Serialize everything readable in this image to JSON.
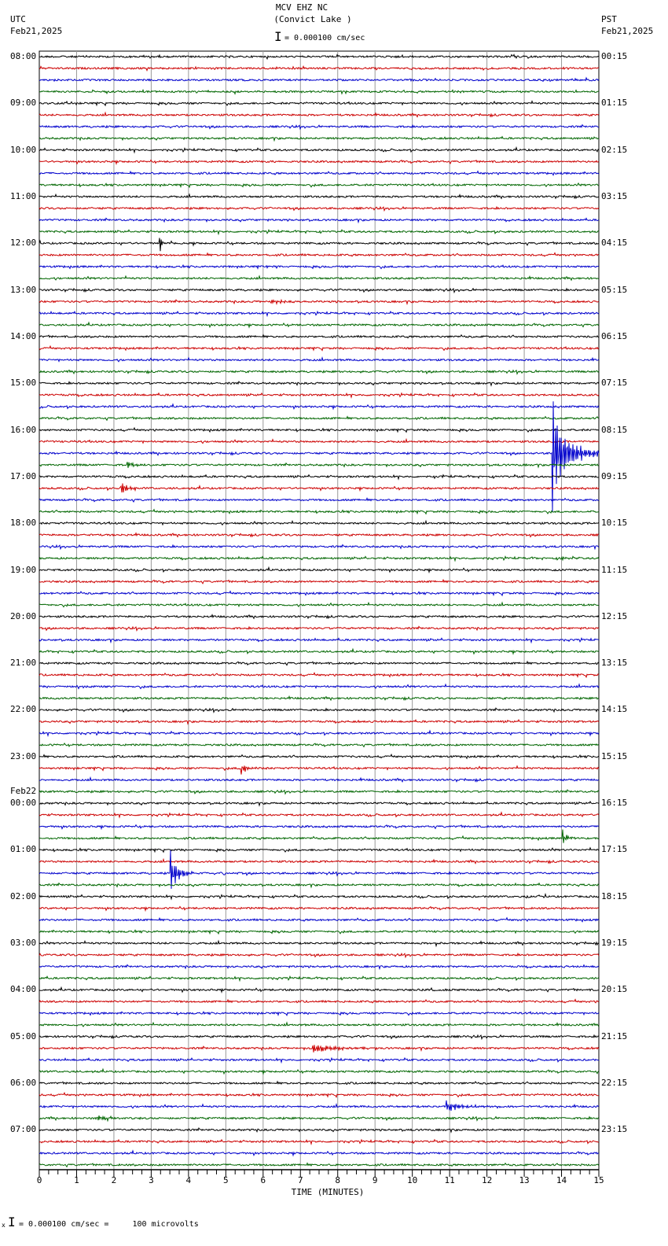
{
  "header": {
    "station": "MCV EHZ NC",
    "location": "(Convict Lake )",
    "scale": "= 0.000100 cm/sec",
    "left_tz": "UTC",
    "left_date": "Feb21,2025",
    "right_tz": "PST",
    "right_date": "Feb21,2025"
  },
  "footer": {
    "scale": "= 0.000100 cm/sec =     100 microvolts",
    "mark": "x"
  },
  "chart_data": {
    "type": "line",
    "title": "MCV EHZ NC (Convict Lake )",
    "xlabel": "TIME (MINUTES)",
    "xlim": [
      0,
      15
    ],
    "x_ticks": [
      "0",
      "1",
      "2",
      "3",
      "4",
      "5",
      "6",
      "7",
      "8",
      "9",
      "10",
      "11",
      "12",
      "13",
      "14",
      "15"
    ],
    "traces_per_hour": 4,
    "trace_count": 96,
    "trace_colors": [
      "#000000",
      "#cc0000",
      "#0000cc",
      "#006600"
    ],
    "left_labels": [
      "08:00",
      "09:00",
      "10:00",
      "11:00",
      "12:00",
      "13:00",
      "14:00",
      "15:00",
      "16:00",
      "17:00",
      "18:00",
      "19:00",
      "20:00",
      "21:00",
      "22:00",
      "23:00",
      "00:00",
      "01:00",
      "02:00",
      "03:00",
      "04:00",
      "05:00",
      "06:00",
      "07:00"
    ],
    "date_change_label": "Feb22",
    "right_labels": [
      "00:15",
      "01:15",
      "02:15",
      "03:15",
      "04:15",
      "05:15",
      "06:15",
      "07:15",
      "08:15",
      "09:15",
      "10:15",
      "11:15",
      "12:15",
      "13:15",
      "14:15",
      "15:15",
      "16:15",
      "17:15",
      "18:15",
      "19:15",
      "20:15",
      "21:15",
      "22:15",
      "23:15"
    ],
    "events": [
      {
        "trace": 16,
        "minute": 3.22,
        "amp": 30,
        "dur": 0.08,
        "dir": 1
      },
      {
        "trace": 18,
        "minute": 6.05,
        "amp": 3,
        "dur": 0.1,
        "dir": 0
      },
      {
        "trace": 21,
        "minute": 6.2,
        "amp": 6,
        "dur": 0.9,
        "dir": 0
      },
      {
        "trace": 34,
        "minute": 13.75,
        "amp": 95,
        "dur": 1.2,
        "dir": 0
      },
      {
        "trace": 35,
        "minute": 2.35,
        "amp": 8,
        "dur": 0.5,
        "dir": 0
      },
      {
        "trace": 36,
        "minute": 10.5,
        "amp": 4,
        "dur": 0.1,
        "dir": 0
      },
      {
        "trace": 37,
        "minute": 2.15,
        "amp": 22,
        "dur": 0.4,
        "dir": 0
      },
      {
        "trace": 38,
        "minute": 4.0,
        "amp": 3,
        "dur": 0.1,
        "dir": 0
      },
      {
        "trace": 43,
        "minute": 13.95,
        "amp": 8,
        "dur": 0.15,
        "dir": 0
      },
      {
        "trace": 54,
        "minute": 1.0,
        "amp": 4,
        "dur": 0.1,
        "dir": 0
      },
      {
        "trace": 61,
        "minute": 5.4,
        "amp": 14,
        "dur": 0.4,
        "dir": 0
      },
      {
        "trace": 67,
        "minute": 14.02,
        "amp": 16,
        "dur": 0.3,
        "dir": 0
      },
      {
        "trace": 70,
        "minute": 3.5,
        "amp": 50,
        "dur": 0.5,
        "dir": 0
      },
      {
        "trace": 70,
        "minute": 4.95,
        "amp": 4,
        "dur": 0.1,
        "dir": 0
      },
      {
        "trace": 72,
        "minute": 13.05,
        "amp": 5,
        "dur": 0.1,
        "dir": 0
      },
      {
        "trace": 76,
        "minute": 10.6,
        "amp": 4,
        "dur": 0.1,
        "dir": 0
      },
      {
        "trace": 80,
        "minute": 10.5,
        "amp": 3,
        "dur": 0.15,
        "dir": 0
      },
      {
        "trace": 85,
        "minute": 7.3,
        "amp": 12,
        "dur": 1.6,
        "dir": 0
      },
      {
        "trace": 90,
        "minute": 10.9,
        "amp": 11,
        "dur": 1.4,
        "dir": 0
      },
      {
        "trace": 91,
        "minute": 1.5,
        "amp": 6,
        "dur": 0.9,
        "dir": 0
      }
    ]
  }
}
